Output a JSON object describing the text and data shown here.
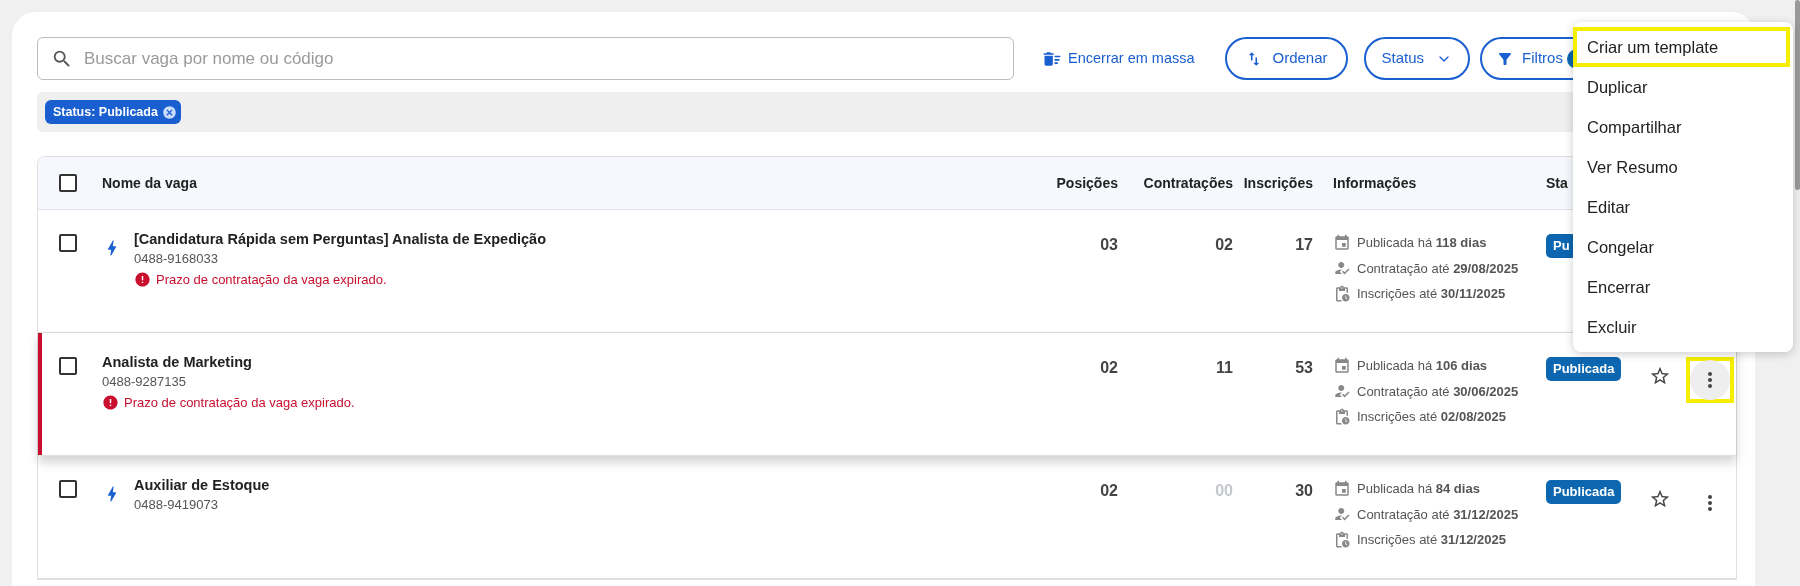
{
  "search": {
    "placeholder": "Buscar vaga por nome ou código"
  },
  "toolbar": {
    "bulk_close": "Encerrar em massa",
    "sort": "Ordenar",
    "status": "Status",
    "filters": "Filtros"
  },
  "active_filters": [
    {
      "label": "Status: Publicada"
    }
  ],
  "table": {
    "select_all_checked": false,
    "columns": [
      "Nome da vaga",
      "Posições",
      "Contratações",
      "Inscrições",
      "Informações",
      "Sta"
    ],
    "rows": [
      {
        "checked": false,
        "selected": false,
        "quick_apply": true,
        "name": "[Candidatura Rápida sem Perguntas] Analista de Expedição",
        "code": "0488-9168033",
        "warning": "Prazo de contratação da vaga expirado.",
        "positions": "03",
        "hires": "02",
        "hires_dimmed": false,
        "applications": "17",
        "info": [
          {
            "kind": "published",
            "text": "Publicada há **118 dias**"
          },
          {
            "kind": "hire",
            "text": "Contratação até **29/08/2025**"
          },
          {
            "kind": "applications",
            "text": "Inscrições até **30/11/2025**"
          }
        ],
        "status": "Pu"
      },
      {
        "checked": false,
        "selected": true,
        "quick_apply": false,
        "name": "Analista de Marketing",
        "code": "0488-9287135",
        "warning": "Prazo de contratação da vaga expirado.",
        "positions": "02",
        "hires": "11",
        "hires_dimmed": false,
        "applications": "53",
        "info": [
          {
            "kind": "published",
            "text": "Publicada há **106 dias**"
          },
          {
            "kind": "hire",
            "text": "Contratação até **30/06/2025**"
          },
          {
            "kind": "applications",
            "text": "Inscrições até **02/08/2025**"
          }
        ],
        "status": "Publicada",
        "favorite": false,
        "more_highlighted": true
      },
      {
        "checked": false,
        "selected": false,
        "quick_apply": true,
        "name": "Auxiliar de Estoque",
        "code": "0488-9419073",
        "positions": "02",
        "hires": "00",
        "hires_dimmed": true,
        "applications": "30",
        "info": [
          {
            "kind": "published",
            "text": "Publicada há **84 dias**"
          },
          {
            "kind": "hire",
            "text": "Contratação até **31/12/2025**"
          },
          {
            "kind": "applications",
            "text": "Inscrições até **31/12/2025**"
          }
        ],
        "status": "Publicada",
        "favorite": false,
        "more_highlighted": false
      }
    ]
  },
  "context_menu": {
    "items": [
      {
        "label": "Criar um template",
        "highlighted": true
      },
      {
        "label": "Duplicar",
        "highlighted": false
      },
      {
        "label": "Compartilhar",
        "highlighted": false
      },
      {
        "label": "Ver Resumo",
        "highlighted": false
      },
      {
        "label": "Editar",
        "highlighted": false
      },
      {
        "label": "Congelar",
        "highlighted": false
      },
      {
        "label": "Encerrar",
        "highlighted": false
      },
      {
        "label": "Excluir",
        "highlighted": false
      }
    ]
  }
}
